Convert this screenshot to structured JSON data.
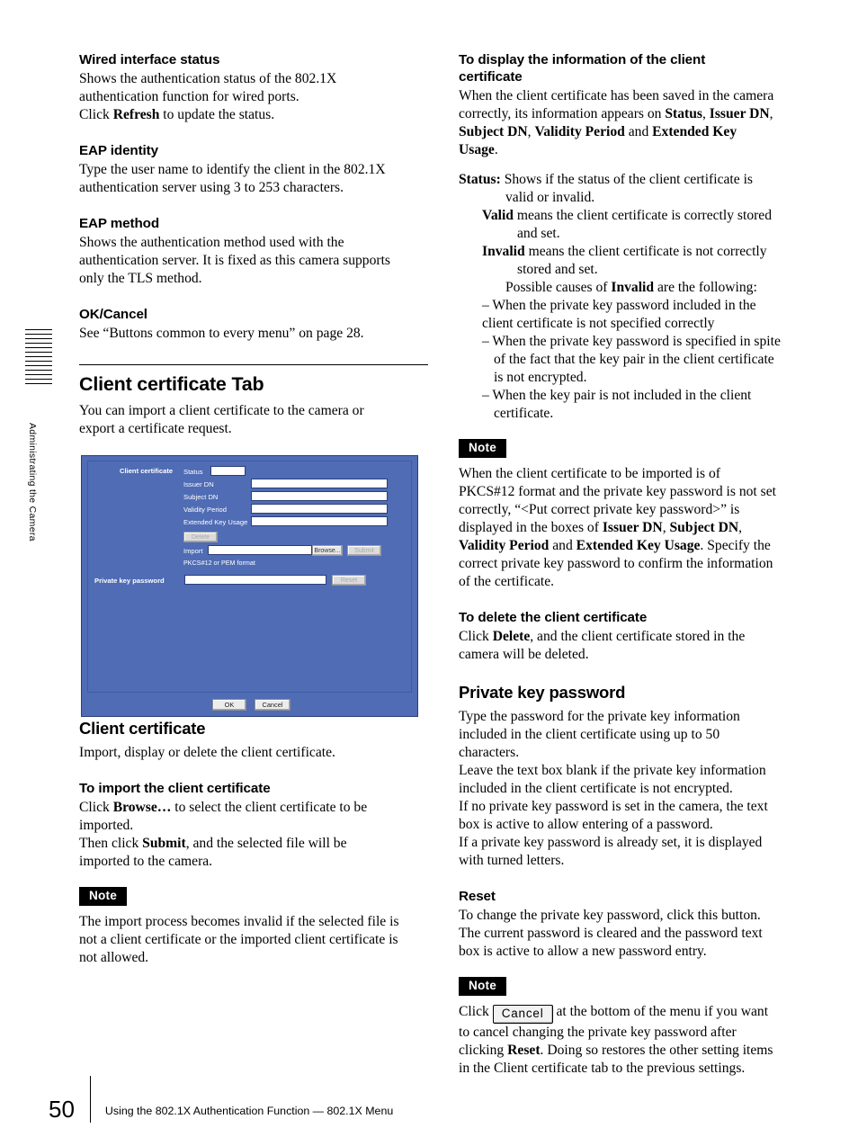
{
  "side_tab": {
    "label": "Administrating the Camera",
    "rule_count": 13
  },
  "left_column": {
    "sections": [
      {
        "heading": "Wired interface status",
        "lines": [
          "Shows the authentication status of the 802.1X",
          "authentication function for wired ports.",
          "Click Refresh to update the status."
        ]
      },
      {
        "heading": "EAP identity",
        "lines": [
          "Type the user name to identify the client in the 802.1X",
          "authentication server using 3 to 253 characters."
        ]
      },
      {
        "heading": "EAP method",
        "lines": [
          "Shows the authentication method used with the",
          "authentication server. It is fixed as this camera supports",
          "only the TLS method."
        ]
      },
      {
        "heading": "OK/Cancel",
        "lines": [
          "See “Buttons common to every menu” on page 28."
        ]
      }
    ],
    "big_heading": "Client certificate Tab",
    "big_intro": [
      "You can import a client certificate to the camera or",
      "export a certificate request."
    ],
    "after_shot": [
      {
        "heading": "Client certificate",
        "lines": [
          "Import, display or delete the client certificate."
        ]
      },
      {
        "heading": "To import the client certificate",
        "lines": [
          "Click Browse… to select the client certificate to be",
          "imported.",
          "Then click Submit, and the selected file will be",
          "imported to the camera."
        ]
      }
    ],
    "note": {
      "badge": "Note",
      "lines": [
        "The import process becomes invalid if the selected file is",
        "not a client certificate or the imported client certificate is",
        "not allowed."
      ]
    }
  },
  "right_column": {
    "heading_1_line1": "To display the information of the client",
    "heading_1_line2": "certificate",
    "intro": [
      "When the client certificate has been saved in the camera",
      "correctly, its information appears on Status, Issuer DN,",
      "Subject DN, Validity Period and Extended Key",
      "Usage."
    ],
    "status_label": "Status:",
    "status_desc_1": "Shows if the status of the client certificate is",
    "status_desc_2": "valid or invalid.",
    "valid_label": "Valid",
    "valid_desc_1": "means the client certificate is correctly stored",
    "valid_desc_2": "and set.",
    "invalid_label": "Invalid",
    "invalid_desc_1": "means the client certificate is not correctly",
    "invalid_desc_2": "stored and set.",
    "causes_line": "Possible causes of Invalid are the following:",
    "causes": [
      [
        "When the private key password included in the",
        "client certificate is not specified correctly"
      ],
      [
        "When the private key password is specified in spite",
        "of the fact that the key pair in the client certificate",
        "is not encrypted."
      ],
      [
        "When the key pair is not included in the client",
        "certificate."
      ]
    ],
    "note_1": {
      "badge": "Note",
      "lines": [
        "When the client certificate to be imported is of",
        "PKCS#12 format and the private key password is not set",
        "correctly, “<Put correct private key password>” is",
        "displayed in the boxes of Issuer DN, Subject DN,",
        "Validity Period and Extended Key Usage. Specify the",
        "correct private key password to confirm the information",
        "of the certificate."
      ]
    },
    "delete_section": {
      "heading": "To delete the client certificate",
      "lines": [
        "Click Delete, and the client certificate stored in the",
        "camera will be deleted."
      ]
    },
    "private_key_section": {
      "heading": "Private key password",
      "lines": [
        "Type the password for the private key information",
        "included in the client certificate using up to 50",
        "characters.",
        "Leave the text box blank if the private key information",
        "included in the client certificate is not encrypted.",
        "If no private key password is set in the camera, the text",
        "box is active to allow entering of a password.",
        "If a private key password is already set, it is displayed",
        "with turned letters."
      ]
    },
    "reset_section": {
      "heading": "Reset",
      "lines": [
        "To change the private key password, click this button.",
        "The current password is cleared and the password text",
        "box is active to allow a new password entry."
      ]
    },
    "note_2": {
      "badge": "Note",
      "click_word": "Click",
      "inline_button": "Cancel",
      "lines": [
        "at the bottom of the menu if you want",
        "to cancel changing the private key password after",
        "clicking Reset. Doing so restores the other setting items",
        "in the Client certificate tab to the previous settings."
      ]
    }
  },
  "screenshot": {
    "panel_color": "#4f6cb5",
    "group_label": "Client certificate",
    "fields": [
      {
        "label": "Status"
      },
      {
        "label": "Issuer DN"
      },
      {
        "label": "Subject DN"
      },
      {
        "label": "Validity Period"
      },
      {
        "label": "Extended Key Usage"
      }
    ],
    "delete_button": "Delete",
    "import_label": "Import",
    "browse_button": "Browse...",
    "submit_button": "Submit",
    "format_hint": "PKCS#12 or PEM format",
    "private_key_label": "Private key password",
    "reset_button": "Reset",
    "ok_button": "OK",
    "cancel_button": "Cancel"
  },
  "footer": {
    "page_number": "50",
    "text": "Using the 802.1X Authentication Function — 802.1X Menu"
  }
}
